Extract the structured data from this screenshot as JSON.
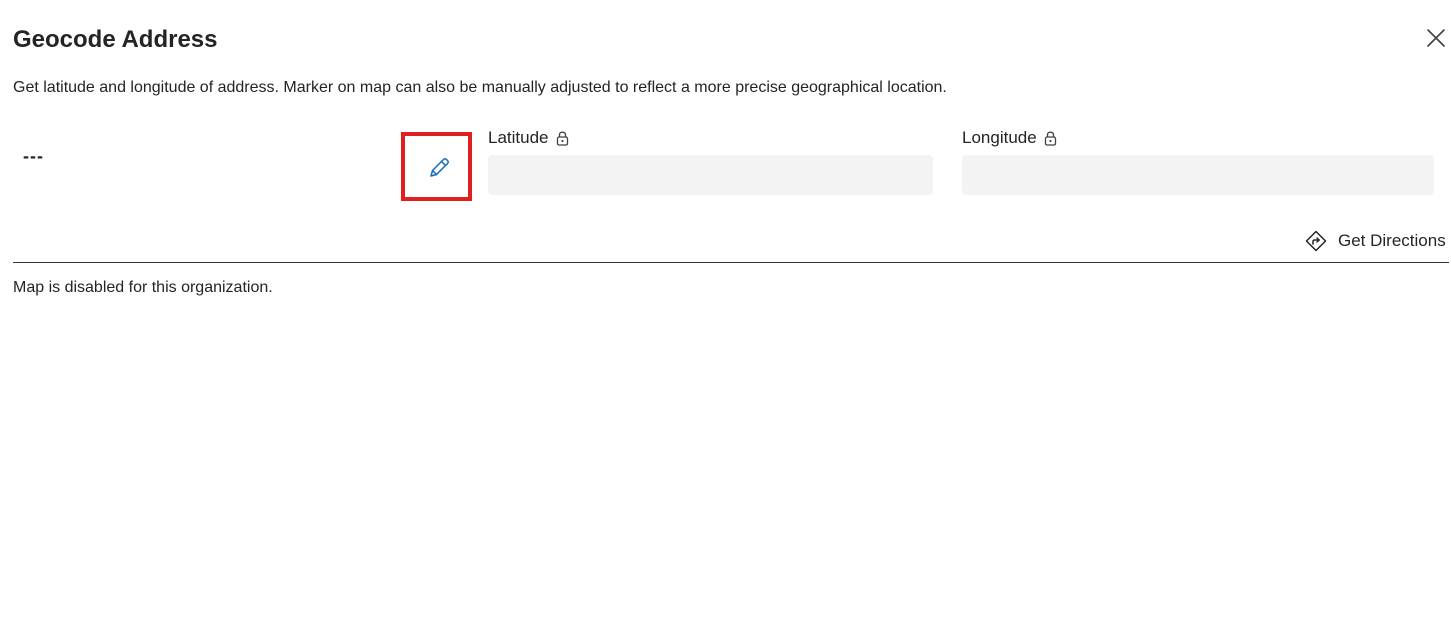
{
  "dialog": {
    "title": "Geocode Address",
    "description": "Get latitude and longitude of address. Marker on map can also be manually adjusted to reflect a more precise geographical location.",
    "close_icon": "close-icon"
  },
  "address": {
    "value": "---",
    "edit_icon": "pencil-icon",
    "highlight_color": "#e02020"
  },
  "fields": {
    "latitude": {
      "label": "Latitude",
      "value": "",
      "lock_icon": "lock-icon",
      "background": "#f3f3f3"
    },
    "longitude": {
      "label": "Longitude",
      "value": "",
      "lock_icon": "lock-icon",
      "background": "#f3f3f3"
    }
  },
  "directions": {
    "label": "Get Directions",
    "icon": "directions-icon"
  },
  "map": {
    "message": "Map is disabled for this organization."
  },
  "colors": {
    "accent": "#0f6cbd",
    "text": "#242424"
  }
}
